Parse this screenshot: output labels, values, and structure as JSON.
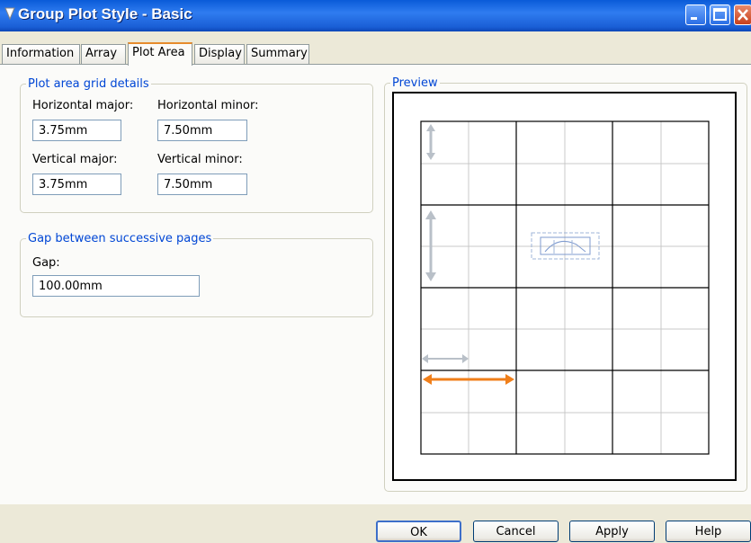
{
  "window": {
    "title": "Group Plot Style - Basic",
    "icons": [
      "app-icon",
      "minimize-icon",
      "maximize-icon",
      "close-icon"
    ]
  },
  "tabs": [
    "Information",
    "Array",
    "Plot Area",
    "Display",
    "Summary"
  ],
  "active_tab": "Plot Area",
  "grid_group": {
    "legend": "Plot area grid details",
    "horizontal_major_label": "Horizontal major:",
    "horizontal_major_value": "3.75mm",
    "horizontal_minor_label": "Horizontal minor:",
    "horizontal_minor_value": "7.50mm",
    "vertical_major_label": "Vertical major:",
    "vertical_major_value": "3.75mm",
    "vertical_minor_label": "Vertical minor:",
    "vertical_minor_value": "7.50mm"
  },
  "gap_group": {
    "legend": "Gap between successive pages",
    "gap_label": "Gap:",
    "gap_value": "100.00mm"
  },
  "preview": {
    "legend": "Preview",
    "highlight_color": "#f07f1a",
    "grid_color": "#000000",
    "minor_grid_color": "#c8c8c8"
  },
  "buttons": {
    "ok": "OK",
    "cancel": "Cancel",
    "apply": "Apply",
    "help": "Help"
  }
}
